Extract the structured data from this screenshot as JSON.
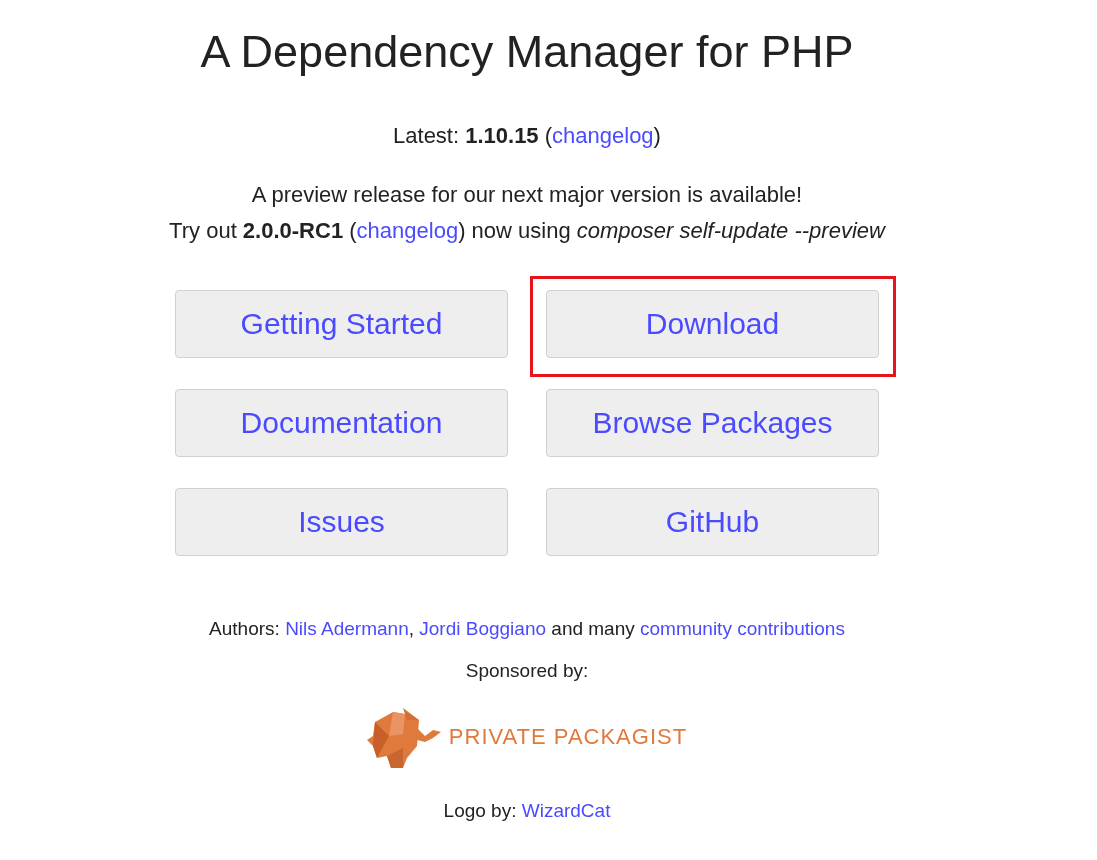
{
  "title": "A Dependency Manager for PHP",
  "latest": [
    {
      "kind": "text",
      "text": "Latest: **1.10.15** ("
    },
    {
      "kind": "link",
      "text": "changelog"
    },
    {
      "kind": "text",
      "text": ")"
    }
  ],
  "preview_lines": [
    [
      {
        "kind": "text",
        "text": "A preview release for our next major version is available!"
      }
    ],
    [
      {
        "kind": "text",
        "text": "Try out **2.0.0-RC1** ("
      },
      {
        "kind": "link",
        "text": "changelog"
      },
      {
        "kind": "text",
        "text": ") now using *composer self-update --preview*"
      }
    ]
  ],
  "buttons": [
    {
      "label": "Getting Started",
      "highlighted": false
    },
    {
      "label": "Download",
      "highlighted": true
    },
    {
      "label": "Documentation",
      "highlighted": false
    },
    {
      "label": "Browse Packages",
      "highlighted": false
    },
    {
      "label": "Issues",
      "highlighted": false
    },
    {
      "label": "GitHub",
      "highlighted": false
    }
  ],
  "authors": [
    {
      "kind": "text",
      "text": "Authors: "
    },
    {
      "kind": "link",
      "text": "Nils Adermann"
    },
    {
      "kind": "text",
      "text": ", "
    },
    {
      "kind": "link",
      "text": "Jordi Boggiano"
    },
    {
      "kind": "text",
      "text": " and many "
    },
    {
      "kind": "link",
      "text": "community contributions"
    }
  ],
  "sponsored": "Sponsored by:",
  "sponsor_logo_text": "PRIVATE PACKAGIST",
  "logo_by": [
    {
      "kind": "text",
      "text": "Logo by: "
    },
    {
      "kind": "link",
      "text": "WizardCat"
    }
  ]
}
